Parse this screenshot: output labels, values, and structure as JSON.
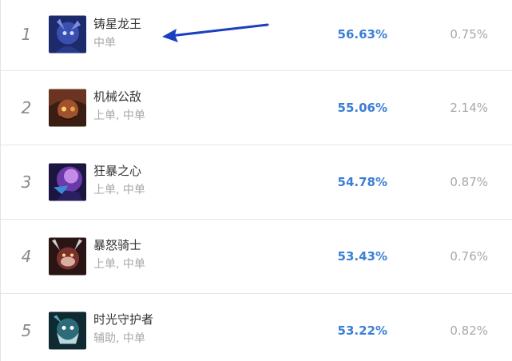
{
  "rows": [
    {
      "rank": "1",
      "name": "铸星龙王",
      "roles": "中单",
      "winrate": "56.63%",
      "pickrate": "0.75%",
      "avatar_icon": "champion-portrait-icon",
      "colors": [
        "#1d2a6b",
        "#3b4fb0",
        "#7c8ce0"
      ]
    },
    {
      "rank": "2",
      "name": "机械公敌",
      "roles": "上单, 中单",
      "winrate": "55.06%",
      "pickrate": "2.14%",
      "avatar_icon": "champion-portrait-icon",
      "colors": [
        "#3a1e14",
        "#a0522d",
        "#e3a34c"
      ]
    },
    {
      "rank": "3",
      "name": "狂暴之心",
      "roles": "上单, 中单",
      "winrate": "54.78%",
      "pickrate": "0.87%",
      "avatar_icon": "champion-portrait-icon",
      "colors": [
        "#1b1540",
        "#6a3aa8",
        "#c58be8"
      ]
    },
    {
      "rank": "4",
      "name": "暴怒骑士",
      "roles": "上单, 中单",
      "winrate": "53.43%",
      "pickrate": "0.76%",
      "avatar_icon": "champion-portrait-icon",
      "colors": [
        "#2a1414",
        "#7a3030",
        "#d8b0a0"
      ]
    },
    {
      "rank": "5",
      "name": "时光守护者",
      "roles": "辅助, 中单",
      "winrate": "53.22%",
      "pickrate": "0.82%",
      "avatar_icon": "champion-portrait-icon",
      "colors": [
        "#0f2a30",
        "#2e6b78",
        "#b8d8e0"
      ]
    }
  ],
  "annotation": {
    "icon": "arrow-left-icon",
    "color": "#1a3fbf"
  },
  "colors": {
    "winrate": "#3a7fd5",
    "muted": "#a8a8a8",
    "name": "#333333",
    "divider": "#e6e6e6"
  }
}
